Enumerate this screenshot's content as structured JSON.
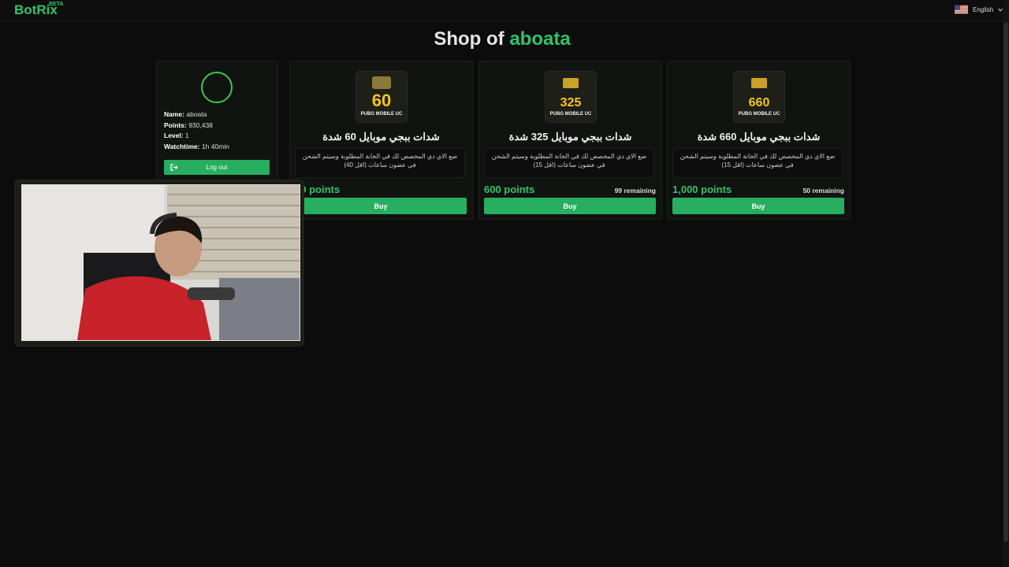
{
  "header": {
    "logo": "BotRix",
    "beta": "BETA",
    "language": "English"
  },
  "page": {
    "title_prefix": "Shop of",
    "streamer": "aboata"
  },
  "profile": {
    "name_label": "Name:",
    "name_value": "aboata",
    "points_label": "Points:",
    "points_value": "930,438",
    "level_label": "Level:",
    "level_value": "1",
    "watchtime_label": "Watchtime:",
    "watchtime_value": "1h 40min",
    "logout_label": "Log out"
  },
  "items": [
    {
      "title": "شدات ببجي موبايل 60 شدة",
      "description": "ضع الاي دي المخصص لك في الخانة المطلوبة وسيتم الشحن في عضون ساعات (اقل 40)",
      "price": "49 points",
      "remaining": "",
      "buy_label": "Buy",
      "thumb_amount": "60",
      "thumb_caption": "PUBG MOBILE UC"
    },
    {
      "title": "شدات ببجي موبايل 325 شدة",
      "description": "ضع الاي دي المخصص لك في الخانة المطلوبة وسيتم الشحن في عضون ساعات (اقل 15)",
      "price": "600 points",
      "remaining": "99 remaining",
      "buy_label": "Buy",
      "thumb_amount": "325",
      "thumb_caption": "PUBG MOBILE UC"
    },
    {
      "title": "شدات ببجي موبايل 660 شدة",
      "description": "ضع الاي دي المخصص لك في الخانة المطلوبة وسيتم الشحن في عضون ساعات (اقل 15)",
      "price": "1,000 points",
      "remaining": "50 remaining",
      "buy_label": "Buy",
      "thumb_amount": "660",
      "thumb_caption": "PUBG MOBILE UC"
    }
  ],
  "colors": {
    "accent": "#2fc46a",
    "button": "#27ae60",
    "background": "#0b0c0b",
    "card": "#111311"
  },
  "icons": {
    "flag": "us-flag-icon",
    "chevron": "chevron-down-icon",
    "logout": "logout-icon",
    "avatar": "avatar-ring-icon"
  }
}
